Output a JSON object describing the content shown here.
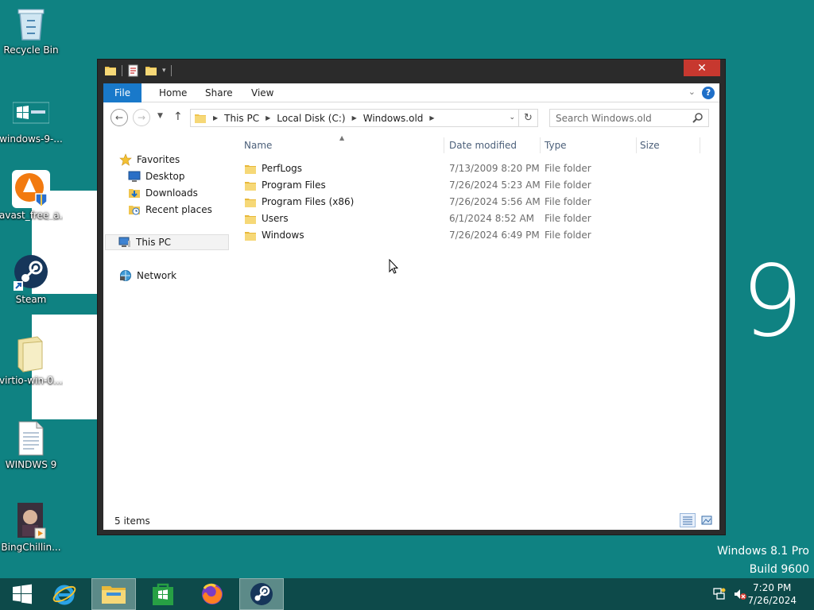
{
  "desktop": {
    "icons": [
      {
        "label": "Recycle Bin"
      },
      {
        "label": "windows-9-..."
      },
      {
        "label": "avast_free_a..."
      },
      {
        "label": "Steam"
      },
      {
        "label": "virtio-win-0...."
      },
      {
        "label": "WINDWS 9"
      },
      {
        "label": "BingChillin..."
      }
    ],
    "big_number": "9",
    "watermark_line1": "Windows 8.1 Pro",
    "watermark_line2": "Build 9600"
  },
  "window": {
    "close_symbol": "✕",
    "ribbon": {
      "tabs": [
        "File",
        "Home",
        "Share",
        "View"
      ],
      "help_symbol": "?"
    },
    "address": {
      "crumbs": [
        "This PC",
        "Local Disk (C:)",
        "Windows.old"
      ]
    },
    "search": {
      "placeholder": "Search Windows.old"
    },
    "nav": {
      "favorites": "Favorites",
      "desktop": "Desktop",
      "downloads": "Downloads",
      "recent": "Recent places",
      "this_pc": "This PC",
      "network": "Network"
    },
    "columns": {
      "name": "Name",
      "date": "Date modified",
      "type": "Type",
      "size": "Size"
    },
    "files": [
      {
        "name": "PerfLogs",
        "date": "7/13/2009 8:20 PM",
        "type": "File folder"
      },
      {
        "name": "Program Files",
        "date": "7/26/2024 5:23 AM",
        "type": "File folder"
      },
      {
        "name": "Program Files (x86)",
        "date": "7/26/2024 5:56 AM",
        "type": "File folder"
      },
      {
        "name": "Users",
        "date": "6/1/2024 8:52 AM",
        "type": "File folder"
      },
      {
        "name": "Windows",
        "date": "7/26/2024 6:49 PM",
        "type": "File folder"
      }
    ],
    "status": "5 items"
  },
  "taskbar": {
    "clock_time": "7:20 PM",
    "clock_date": "7/26/2024"
  },
  "colors": {
    "desktop": "#0f8282",
    "taskbar": "#0d4a4a",
    "accent": "#1979ca",
    "close": "#c7382f",
    "folder": "#f0c54e"
  }
}
